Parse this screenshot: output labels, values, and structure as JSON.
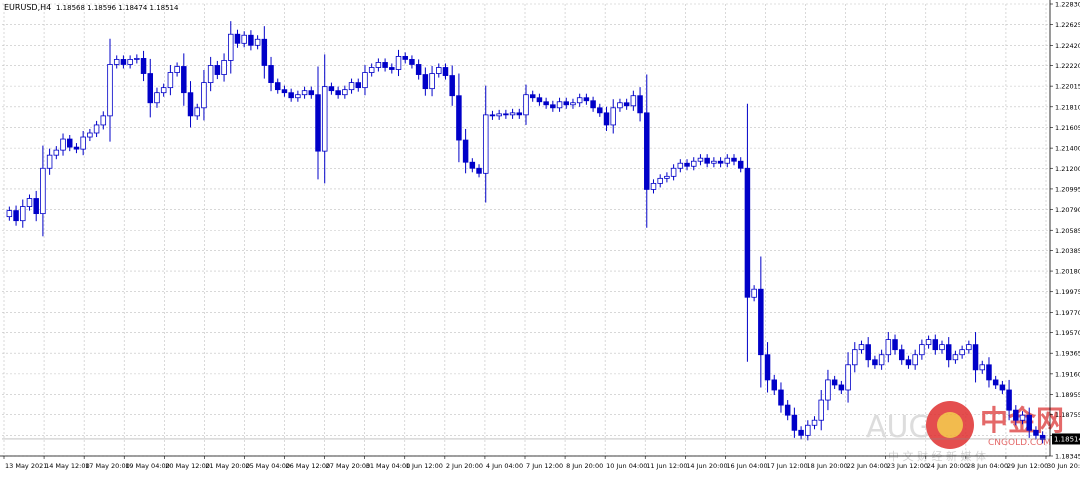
{
  "header": {
    "symbol": "EURUSD,H4",
    "ohlc": "1.18568 1.18596 1.18474 1.18514"
  },
  "watermark": {
    "brand": "AUG",
    "cn_brand": "中金网",
    "en_brand": "CNGOLD.COM",
    "tagline": "中 文 财 经 新 媒 体"
  },
  "price_label": "1.18514",
  "colors": {
    "candle": "#0000c8",
    "grid": "#c0c0c0",
    "axis_text": "#000000",
    "price_tag_bg": "#000000",
    "price_tag_text": "#ffffff"
  },
  "chart_data": {
    "type": "candlestick",
    "symbol": "EURUSD",
    "timeframe": "H4",
    "ylim": [
      1.18345,
      1.2283
    ],
    "y_ticks": [
      "1.22830",
      "1.22625",
      "1.22420",
      "1.22220",
      "1.22015",
      "1.21810",
      "1.21605",
      "1.21400",
      "1.21200",
      "1.20995",
      "1.20790",
      "1.20585",
      "1.20385",
      "1.20180",
      "1.19975",
      "1.19770",
      "1.19570",
      "1.19365",
      "1.19160",
      "1.18955",
      "1.18755",
      "1.18550",
      "1.18345"
    ],
    "x_ticks": [
      "13 May 2021",
      "14 May 12:00",
      "17 May 20:00",
      "19 May 04:00",
      "20 May 12:00",
      "21 May 20:00",
      "25 May 04:00",
      "26 May 12:00",
      "27 May 20:00",
      "31 May 04:00",
      "1 Jun 12:00",
      "2 Jun 20:00",
      "4 Jun 04:00",
      "7 Jun 12:00",
      "8 Jun 20:00",
      "10 Jun 04:00",
      "11 Jun 12:00",
      "14 Jun 20:00",
      "16 Jun 04:00",
      "17 Jun 12:00",
      "18 Jun 20:00",
      "22 Jun 04:00",
      "23 Jun 12:00",
      "24 Jun 20:00",
      "28 Jun 04:00",
      "29 Jun 12:00",
      "30 Jun 20:00"
    ],
    "closes": [
      1.2078,
      1.2068,
      1.2082,
      1.209,
      1.2075,
      1.212,
      1.2133,
      1.2138,
      1.2149,
      1.2141,
      1.2139,
      1.2151,
      1.2155,
      1.2163,
      1.2172,
      1.2223,
      1.2228,
      1.2223,
      1.2228,
      1.2229,
      1.2214,
      1.2185,
      1.2195,
      1.22,
      1.2215,
      1.2221,
      1.2195,
      1.2172,
      1.218,
      1.2205,
      1.2222,
      1.2213,
      1.2227,
      1.2253,
      1.2244,
      1.2252,
      1.2242,
      1.2248,
      1.2222,
      1.2205,
      1.2198,
      1.2195,
      1.219,
      1.2193,
      1.2197,
      1.2193,
      1.2137,
      1.2201,
      1.2197,
      1.2193,
      1.2198,
      1.2205,
      1.22,
      1.2215,
      1.222,
      1.2225,
      1.222,
      1.2218,
      1.2231,
      1.2228,
      1.2223,
      1.2213,
      1.2199,
      1.2214,
      1.222,
      1.2212,
      1.2192,
      1.2148,
      1.2126,
      1.212,
      1.2115,
      1.2173,
      1.2172,
      1.2174,
      1.2173,
      1.2175,
      1.2173,
      1.2193,
      1.219,
      1.2186,
      1.2183,
      1.218,
      1.2186,
      1.2183,
      1.2185,
      1.219,
      1.2187,
      1.218,
      1.2175,
      1.2163,
      1.218,
      1.2185,
      1.2182,
      1.2192,
      1.2175,
      1.2099,
      1.2105,
      1.211,
      1.2112,
      1.212,
      1.2125,
      1.2122,
      1.2127,
      1.213,
      1.2125,
      1.2127,
      1.2125,
      1.213,
      1.2127,
      1.212,
      1.1992,
      1.2,
      1.1935,
      1.191,
      1.19,
      1.1885,
      1.1875,
      1.186,
      1.1855,
      1.1865,
      1.187,
      1.189,
      1.191,
      1.1905,
      1.19,
      1.1925,
      1.194,
      1.1945,
      1.193,
      1.1925,
      1.1935,
      1.195,
      1.194,
      1.193,
      1.1925,
      1.1935,
      1.1945,
      1.195,
      1.194,
      1.1945,
      1.193,
      1.1935,
      1.194,
      1.1945,
      1.192,
      1.1925,
      1.191,
      1.1905,
      1.19,
      1.188,
      1.187,
      1.1875,
      1.186,
      1.1855,
      1.1851
    ],
    "last_price": 1.18514
  }
}
